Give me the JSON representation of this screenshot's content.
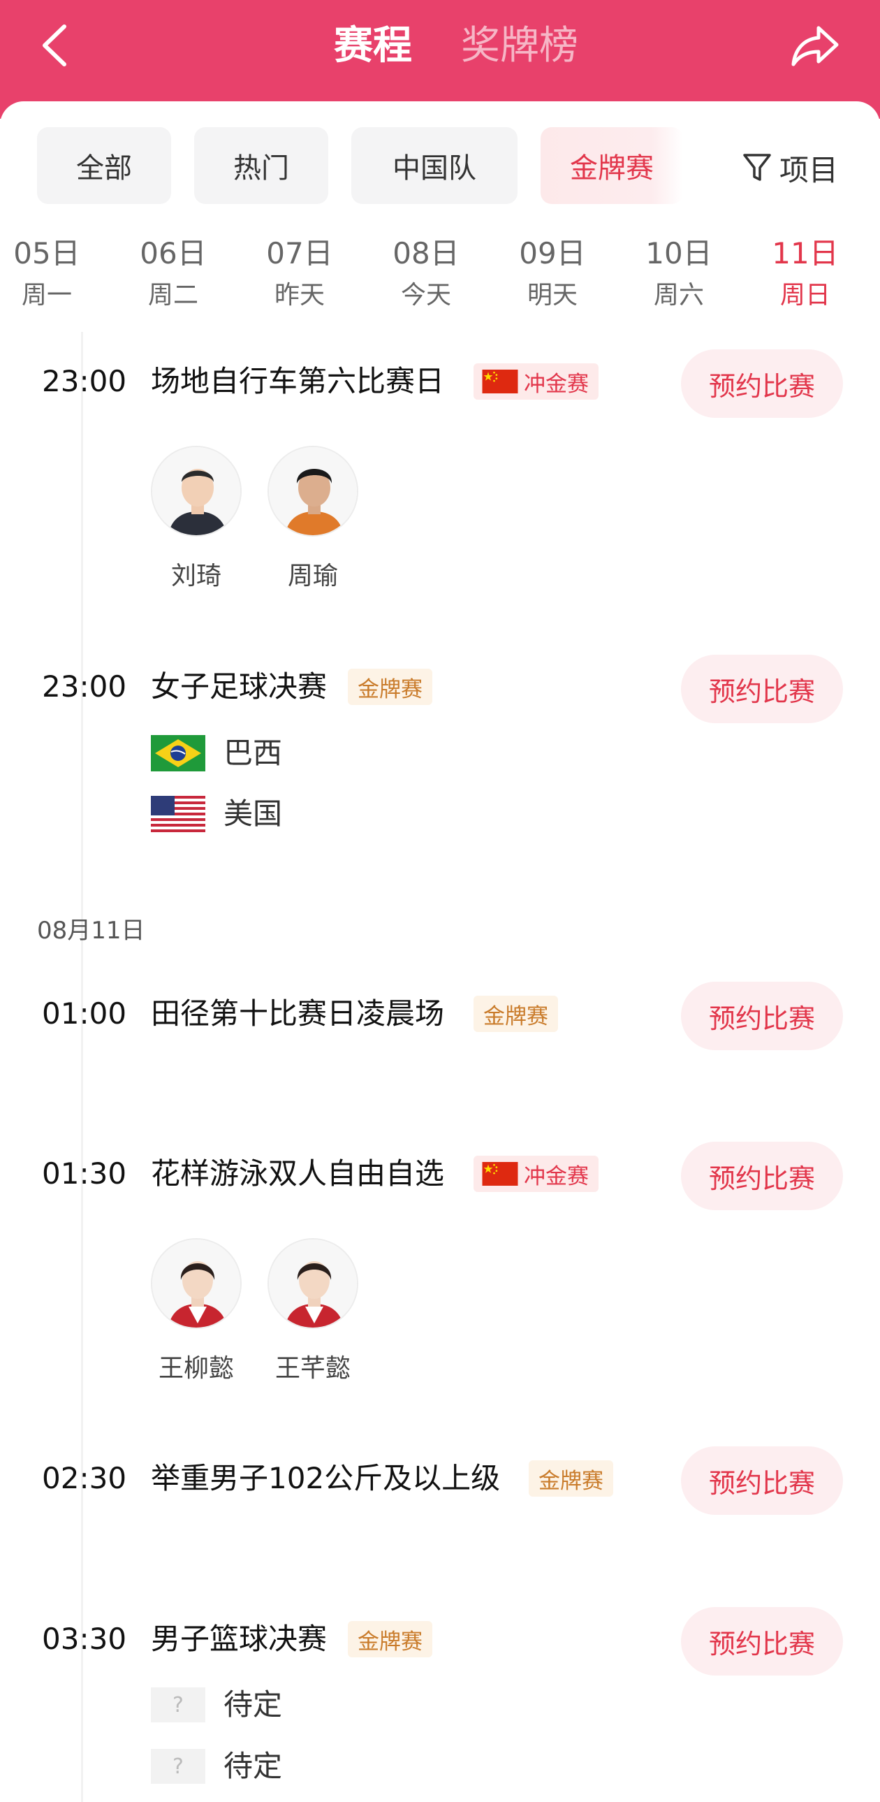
{
  "header": {
    "back_icon": "back-arrow-icon",
    "tabs": [
      {
        "label": "赛程",
        "active": true
      },
      {
        "label": "奖牌榜",
        "active": false
      }
    ],
    "share_icon": "share-icon"
  },
  "filters": {
    "chips": [
      {
        "label": "全部",
        "active": false
      },
      {
        "label": "热门",
        "active": false
      },
      {
        "label": "中国队",
        "active": false
      },
      {
        "label": "金牌赛",
        "active": true
      }
    ],
    "project_label": "项目",
    "project_icon": "filter-funnel-icon"
  },
  "dates": [
    {
      "day": "05日",
      "weekday": "周一",
      "active": false
    },
    {
      "day": "06日",
      "weekday": "周二",
      "active": false
    },
    {
      "day": "07日",
      "weekday": "昨天",
      "active": false
    },
    {
      "day": "08日",
      "weekday": "今天",
      "active": false
    },
    {
      "day": "09日",
      "weekday": "明天",
      "active": false
    },
    {
      "day": "10日",
      "weekday": "周六",
      "active": false
    },
    {
      "day": "11日",
      "weekday": "周日",
      "active": true
    }
  ],
  "section_date": "08月11日",
  "reserve_label": "预约比赛",
  "events": [
    {
      "time": "23:00",
      "title": "场地自行车第六比赛日",
      "badge": "冲金赛",
      "badge_type": "chong",
      "athletes": [
        "刘琦",
        "周瑜"
      ]
    },
    {
      "time": "23:00",
      "title": "女子足球决赛",
      "badge": "金牌赛",
      "badge_type": "gold",
      "teams": [
        {
          "name": "巴西",
          "flag": "brazil-flag-icon"
        },
        {
          "name": "美国",
          "flag": "usa-flag-icon"
        }
      ]
    },
    {
      "time": "01:00",
      "title": "田径第十比赛日凌晨场",
      "badge": "金牌赛",
      "badge_type": "gold"
    },
    {
      "time": "01:30",
      "title": "花样游泳双人自由自选",
      "badge": "冲金赛",
      "badge_type": "chong",
      "athletes": [
        "王柳懿",
        "王芊懿"
      ]
    },
    {
      "time": "02:30",
      "title": "举重男子102公斤及以上级",
      "badge": "金牌赛",
      "badge_type": "gold"
    },
    {
      "time": "03:30",
      "title": "男子篮球决赛",
      "badge": "金牌赛",
      "badge_type": "gold",
      "teams": [
        {
          "name": "待定",
          "flag": "unknown-team-icon",
          "placeholder": "?"
        },
        {
          "name": "待定",
          "flag": "unknown-team-icon",
          "placeholder": "?"
        }
      ]
    }
  ],
  "colors": {
    "brand_red": "#e8416b",
    "accent_red": "#e2364b",
    "gold_badge_text": "#c97b2a"
  }
}
